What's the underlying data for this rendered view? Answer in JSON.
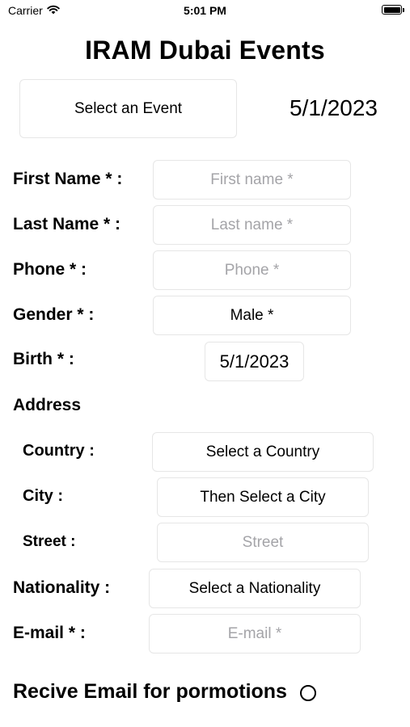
{
  "status_bar": {
    "carrier": "Carrier",
    "time": "5:01 PM",
    "icons": [
      "wifi-icon",
      "battery-icon"
    ]
  },
  "header": {
    "title": "IRAM Dubai Events"
  },
  "event": {
    "select_label": "Select an Event",
    "date": "5/1/2023"
  },
  "form": {
    "first_name": {
      "label": "First Name * :",
      "placeholder": "First name *"
    },
    "last_name": {
      "label": "Last Name * :",
      "placeholder": "Last name *"
    },
    "phone": {
      "label": "Phone * :",
      "placeholder": "Phone *"
    },
    "gender": {
      "label": "Gender * :",
      "value": "Male *"
    },
    "birth": {
      "label": "Birth * :",
      "value": "5/1/2023"
    },
    "address": {
      "heading": "Address",
      "country": {
        "label": "Country :",
        "value": "Select a Country"
      },
      "city": {
        "label": "City :",
        "value": "Then Select a City"
      },
      "street": {
        "label": "Street :",
        "placeholder": "Street"
      }
    },
    "nationality": {
      "label": "Nationality :",
      "value": "Select a Nationality"
    },
    "email": {
      "label": "E-mail * :",
      "placeholder": "E-mail *"
    }
  },
  "promotions": {
    "label": "Recive Email for pormotions",
    "checked": false
  }
}
